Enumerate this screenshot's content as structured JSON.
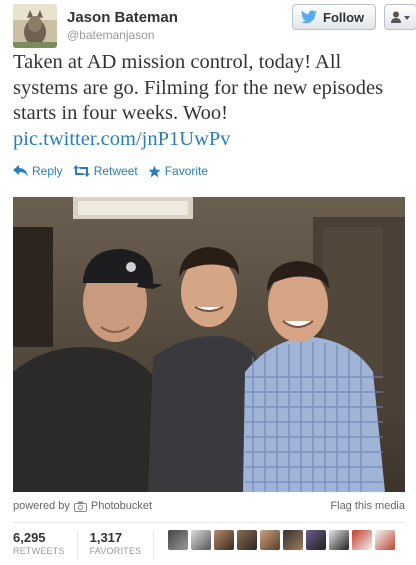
{
  "user": {
    "name": "Jason Bateman",
    "handle": "@batemanjason"
  },
  "buttons": {
    "follow_label": "Follow"
  },
  "tweet": {
    "text": "Taken at AD mission control, today! All systems are go. Filming for the new episodes starts in four weeks. Woo!",
    "link": "pic.twitter.com/jnP1UwPv"
  },
  "actions": {
    "reply": "Reply",
    "retweet": "Retweet",
    "favorite": "Favorite"
  },
  "media": {
    "powered_by": "powered by",
    "provider": "Photobucket",
    "flag": "Flag this media"
  },
  "stats": {
    "retweets": {
      "count": "6,295",
      "label": "RETWEETS"
    },
    "favorites": {
      "count": "1,317",
      "label": "FAVORITES"
    }
  },
  "colors": {
    "link": "#2a7eb6",
    "muted": "#999999",
    "twitter_blue": "#55acee"
  },
  "icons": {
    "follow": "twitter-bird-icon",
    "more": "user-menu-icon",
    "reply": "reply-arrow-icon",
    "retweet": "retweet-icon",
    "favorite": "star-icon",
    "provider": "camera-icon"
  }
}
